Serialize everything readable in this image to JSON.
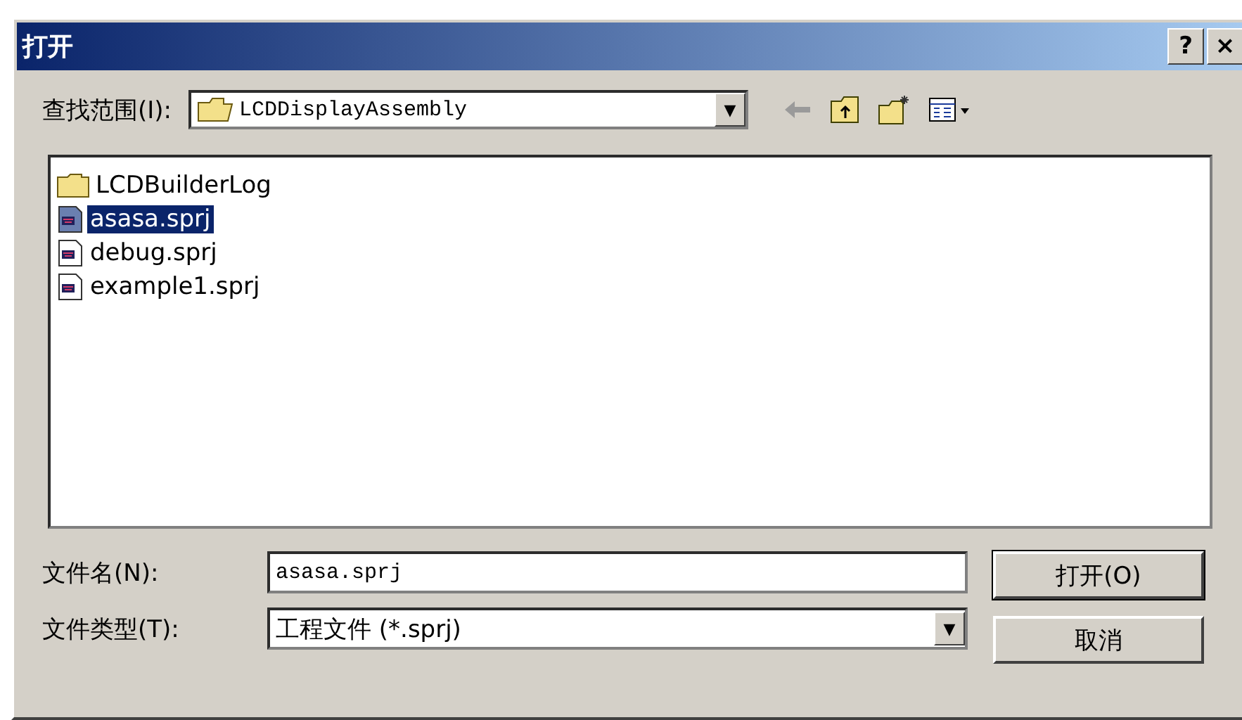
{
  "window": {
    "title": "打开",
    "help": "?",
    "close": "×"
  },
  "look_in": {
    "label": "查找范围(I):",
    "value": "LCDDisplayAssembly",
    "arrow": "▼"
  },
  "files": [
    {
      "name": "LCDBuilderLog",
      "kind": "folder",
      "selected": false
    },
    {
      "name": "asasa.sprj",
      "kind": "file",
      "selected": true
    },
    {
      "name": "debug.sprj",
      "kind": "file",
      "selected": false
    },
    {
      "name": "example1.sprj",
      "kind": "file",
      "selected": false
    }
  ],
  "file_name": {
    "label": "文件名(N):",
    "value": "asasa.sprj"
  },
  "file_type": {
    "label": "文件类型(T):",
    "value": "工程文件 (*.sprj)",
    "arrow": "▼"
  },
  "buttons": [
    {
      "label": "打开(O)",
      "default": true
    },
    {
      "label": "取消",
      "default": false
    }
  ]
}
